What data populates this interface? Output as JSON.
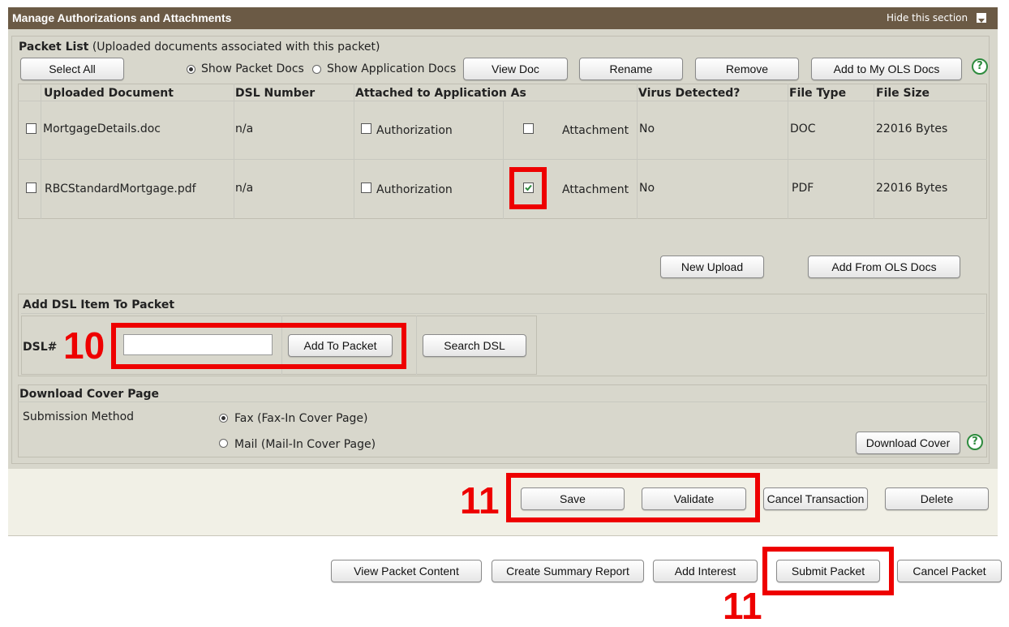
{
  "section": {
    "title": "Manage Authorizations and Attachments",
    "hide_label": "Hide this section"
  },
  "packet_list": {
    "title": "Packet List",
    "subtitle": "(Uploaded documents associated with this packet)",
    "select_all": "Select All",
    "show_packet_docs": "Show Packet Docs",
    "show_application_docs": "Show Application Docs",
    "view_doc": "View Doc",
    "rename": "Rename",
    "remove": "Remove",
    "add_to_my_ols": "Add to My OLS Docs",
    "columns": {
      "uploaded_document": "Uploaded Document",
      "dsl_number": "DSL Number",
      "attached_as": "Attached to Application As",
      "virus": "Virus Detected?",
      "file_type": "File Type",
      "file_size": "File Size"
    },
    "rows": [
      {
        "document": "MortgageDetails.doc",
        "dsl": "n/a",
        "authorization": "Authorization",
        "attachment": "Attachment",
        "attachment_checked": false,
        "virus": "No",
        "type": "DOC",
        "size": "22016 Bytes"
      },
      {
        "document": "RBCStandardMortgage.pdf",
        "dsl": "n/a",
        "authorization": "Authorization",
        "attachment": "Attachment",
        "attachment_checked": true,
        "virus": "No",
        "type": "PDF",
        "size": "22016 Bytes"
      }
    ],
    "new_upload": "New Upload",
    "add_from_ols": "Add From OLS Docs"
  },
  "dsl": {
    "title": "Add DSL Item To Packet",
    "label": "DSL#",
    "input_value": "",
    "add_to_packet": "Add To Packet",
    "search_dsl": "Search DSL"
  },
  "cover": {
    "title": "Download Cover Page",
    "submission_method": "Submission Method",
    "fax": "Fax (Fax-In Cover Page)",
    "mail": "Mail (Mail-In Cover Page)",
    "download_cover": "Download Cover"
  },
  "actions": {
    "save": "Save",
    "validate": "Validate",
    "cancel_transaction": "Cancel Transaction",
    "delete": "Delete"
  },
  "footer": {
    "view_packet_content": "View Packet Content",
    "create_summary_report": "Create Summary Report",
    "add_interest": "Add Interest",
    "submit_packet": "Submit Packet",
    "cancel_packet": "Cancel Packet"
  },
  "annotations": {
    "label_10": "10",
    "label_11a": "11",
    "label_11b": "11"
  },
  "colors": {
    "header_bg": "#6b5a45",
    "panel_bg": "#d8d7cc",
    "action_bar_bg": "#f1f0e6",
    "highlight": "#ee0000",
    "help_green": "#2e8b3e"
  },
  "icons": {
    "hide": "chevron-down-icon",
    "help": "help-icon",
    "check": "checkmark-icon"
  }
}
